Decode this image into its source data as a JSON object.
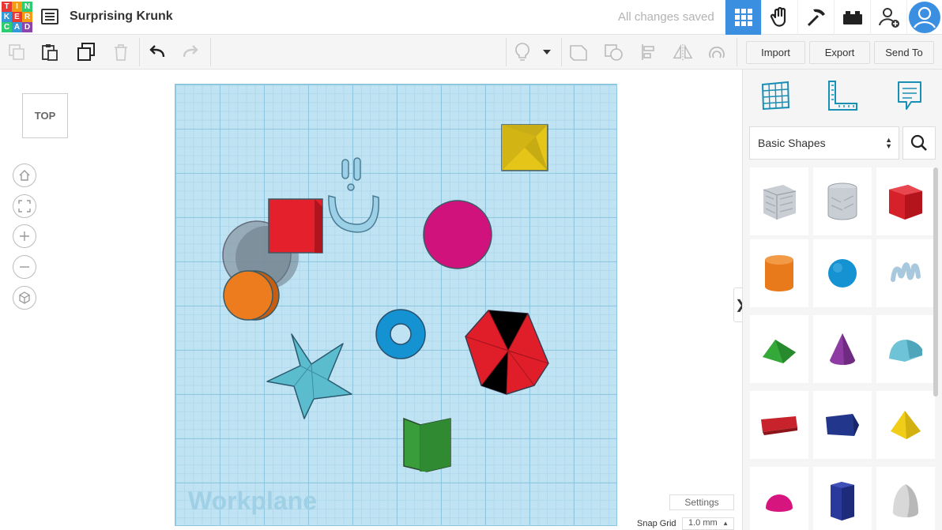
{
  "app": {
    "logo_letters": [
      "T",
      "I",
      "N",
      "K",
      "E",
      "R",
      "C",
      "A",
      "D"
    ],
    "logo_colors": [
      "#e53935",
      "#f39c12",
      "#2ecc71",
      "#3498db",
      "#e53935",
      "#f39c12",
      "#2ecc71",
      "#3498db",
      "#8e44ad"
    ],
    "project_title": "Surprising Krunk",
    "save_status": "All changes saved"
  },
  "top_buttons": [
    {
      "name": "3d-design-view-icon",
      "active": true
    },
    {
      "name": "blocks-view-icon",
      "active": false
    },
    {
      "name": "minecraft-pickaxe-icon",
      "active": false
    },
    {
      "name": "lego-brick-icon",
      "active": false
    },
    {
      "name": "invite-user-icon",
      "active": false
    },
    {
      "name": "profile-avatar-icon",
      "active": false
    }
  ],
  "toolbar": {
    "import_label": "Import",
    "export_label": "Export",
    "send_to_label": "Send To"
  },
  "view": {
    "viewcube_label": "TOP"
  },
  "workplane": {
    "label": "Workplane",
    "settings_label": "Settings",
    "snap_grid_label": "Snap Grid",
    "snap_grid_value": "1.0 mm"
  },
  "shapes_panel": {
    "category": "Basic Shapes",
    "tiles": [
      {
        "name": "box-hole-shape"
      },
      {
        "name": "cylinder-hole-shape"
      },
      {
        "name": "box-shape",
        "color": "#d6202a"
      },
      {
        "name": "cylinder-shape",
        "color": "#e87a1c"
      },
      {
        "name": "sphere-shape",
        "color": "#1592d1"
      },
      {
        "name": "scribble-shape",
        "color": "#a8c8dd"
      },
      {
        "name": "roof-shape",
        "color": "#35a83a"
      },
      {
        "name": "cone-shape",
        "color": "#8e3ca3"
      },
      {
        "name": "round-roof-shape",
        "color": "#6fc3d6"
      },
      {
        "name": "text-shape",
        "color": "#c8232c"
      },
      {
        "name": "wedge-shape",
        "color": "#22378c"
      },
      {
        "name": "pyramid-shape",
        "color": "#f0cd18"
      },
      {
        "name": "half-sphere-shape",
        "color": "#d6167e"
      },
      {
        "name": "polygon-shape",
        "color": "#2a3a9c"
      },
      {
        "name": "paraboloid-shape",
        "color": "#d8d8d8"
      }
    ]
  },
  "colors": {
    "accent": "#3b8fe0",
    "workplane": "#bfe3f2",
    "red_box": "#e3202b",
    "yellow_pyramid": "#e6c519",
    "magenta_sphere": "#d0137c",
    "orange_cylinder": "#ec7c1e",
    "blue_torus": "#1592d1",
    "teal_star": "#5bbccd",
    "red_polyhedron": "#e01e2a",
    "green_box": "#3a9d3c"
  }
}
